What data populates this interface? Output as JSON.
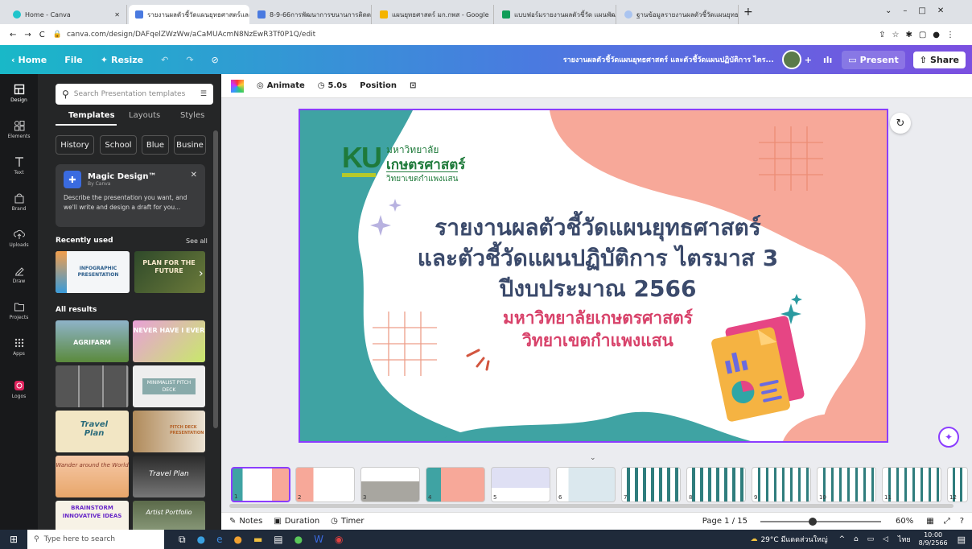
{
  "browser": {
    "tabs": [
      {
        "label": "Home - Canva",
        "active": false
      },
      {
        "label": "รายงานผลตัวชี้วัดแผนยุทธศาสตร์และ",
        "active": true
      },
      {
        "label": "8-9-66การพัฒนาการขนานการติดตาม",
        "active": false
      },
      {
        "label": "แผนยุทธศาสตร์ มก.กพส - Google",
        "active": false
      },
      {
        "label": "แบบฟอร์มรายงานผลตัวชี้วัด แผนพัฒ",
        "active": false
      },
      {
        "label": "ฐานข้อมูลรายงานผลตัวชี้วัดแผนยุทธศ",
        "active": false
      }
    ],
    "new_tab": "+",
    "url": "canva.com/design/DAFqelZWzWw/aCaMUAcmN8NzEwR3Tf0P1Q/edit"
  },
  "topbar": {
    "home": "Home",
    "file": "File",
    "resize": "Resize",
    "doc_title": "รายงานผลตัวชี้วัดแผนยุทธศาสตร์ และตัวชี้วัดแผนปฏิบัติการ ไตร...",
    "present": "Present",
    "share": "Share",
    "add": "+"
  },
  "rail": [
    {
      "label": "Design",
      "icon": "design-icon"
    },
    {
      "label": "Elements",
      "icon": "elements-icon"
    },
    {
      "label": "Text",
      "icon": "text-icon"
    },
    {
      "label": "Brand",
      "icon": "brand-icon"
    },
    {
      "label": "Uploads",
      "icon": "uploads-icon"
    },
    {
      "label": "Draw",
      "icon": "draw-icon"
    },
    {
      "label": "Projects",
      "icon": "projects-icon"
    },
    {
      "label": "Apps",
      "icon": "apps-icon"
    },
    {
      "label": "Logos",
      "icon": "logos-icon"
    }
  ],
  "panel": {
    "search_placeholder": "Search Presentation templates",
    "tabs": [
      "Templates",
      "Layouts",
      "Styles"
    ],
    "chips": [
      "History",
      "School",
      "Blue",
      "Busine"
    ],
    "magic": {
      "title": "Magic Design™",
      "by": "By Canva",
      "desc": "Describe the presentation you want, and we'll write and design a draft for you..."
    },
    "recently_used": "Recently used",
    "see_all": "See all",
    "recent": [
      {
        "title": "INFOGRAPHIC PRESENTATION"
      },
      {
        "title": "PLAN FOR THE FUTURE"
      }
    ],
    "all_results": "All results",
    "results": [
      {
        "title": "AGRIFARM"
      },
      {
        "title": "NEVER HAVE I EVER"
      },
      {
        "title": ""
      },
      {
        "title": "MINIMALIST PITCH DECK"
      },
      {
        "title": "Travel Plan"
      },
      {
        "title": "PITCH DECK PRESENTATION"
      },
      {
        "title": "Wander around the World"
      },
      {
        "title": "Travel Plan"
      },
      {
        "title": "BRAINSTORM INNOVATIVE IDEAS"
      },
      {
        "title": "Artist Portfolio"
      }
    ]
  },
  "editor_toolbar": {
    "animate": "Animate",
    "duration": "5.0s",
    "position": "Position"
  },
  "slide": {
    "logo_mark": "KU",
    "logo_line1": "มหาวิทยาลัย",
    "logo_line2": "เกษตรศาสตร์",
    "logo_line3": "วิทยาเขตกำแพงแสน",
    "title_line1": "รายงานผลตัวชี้วัดแผนยุทธศาสตร์",
    "title_line2": "และตัวชี้วัดแผนปฏิบัติการ ไตรมาส 3",
    "title_line3": "ปีงบประมาณ 2566",
    "sub_line1": "มหาวิทยาลัยเกษตรศาสตร์",
    "sub_line2": "วิทยาเขตกำแพงแสน"
  },
  "filmstrip": [
    "1",
    "2",
    "3",
    "4",
    "5",
    "6",
    "7",
    "8",
    "9",
    "10",
    "11",
    "12"
  ],
  "bottombar": {
    "notes": "Notes",
    "duration": "Duration",
    "timer": "Timer",
    "page": "Page 1 / 15",
    "zoom": "60%",
    "zoom_level": 0.6
  },
  "taskbar": {
    "search": "Type here to search",
    "weather": "29°C มีแดดส่วนใหญ่",
    "lang": "ไทย",
    "time": "10:00",
    "date": "8/9/2566"
  },
  "colors": {
    "accent": "#8b3dff",
    "slide_teal": "#3fa3a3",
    "slide_peach": "#f7a899",
    "title_navy": "#3b4a6b",
    "title_pink": "#d8426a",
    "ku_green": "#1e7a3a"
  }
}
